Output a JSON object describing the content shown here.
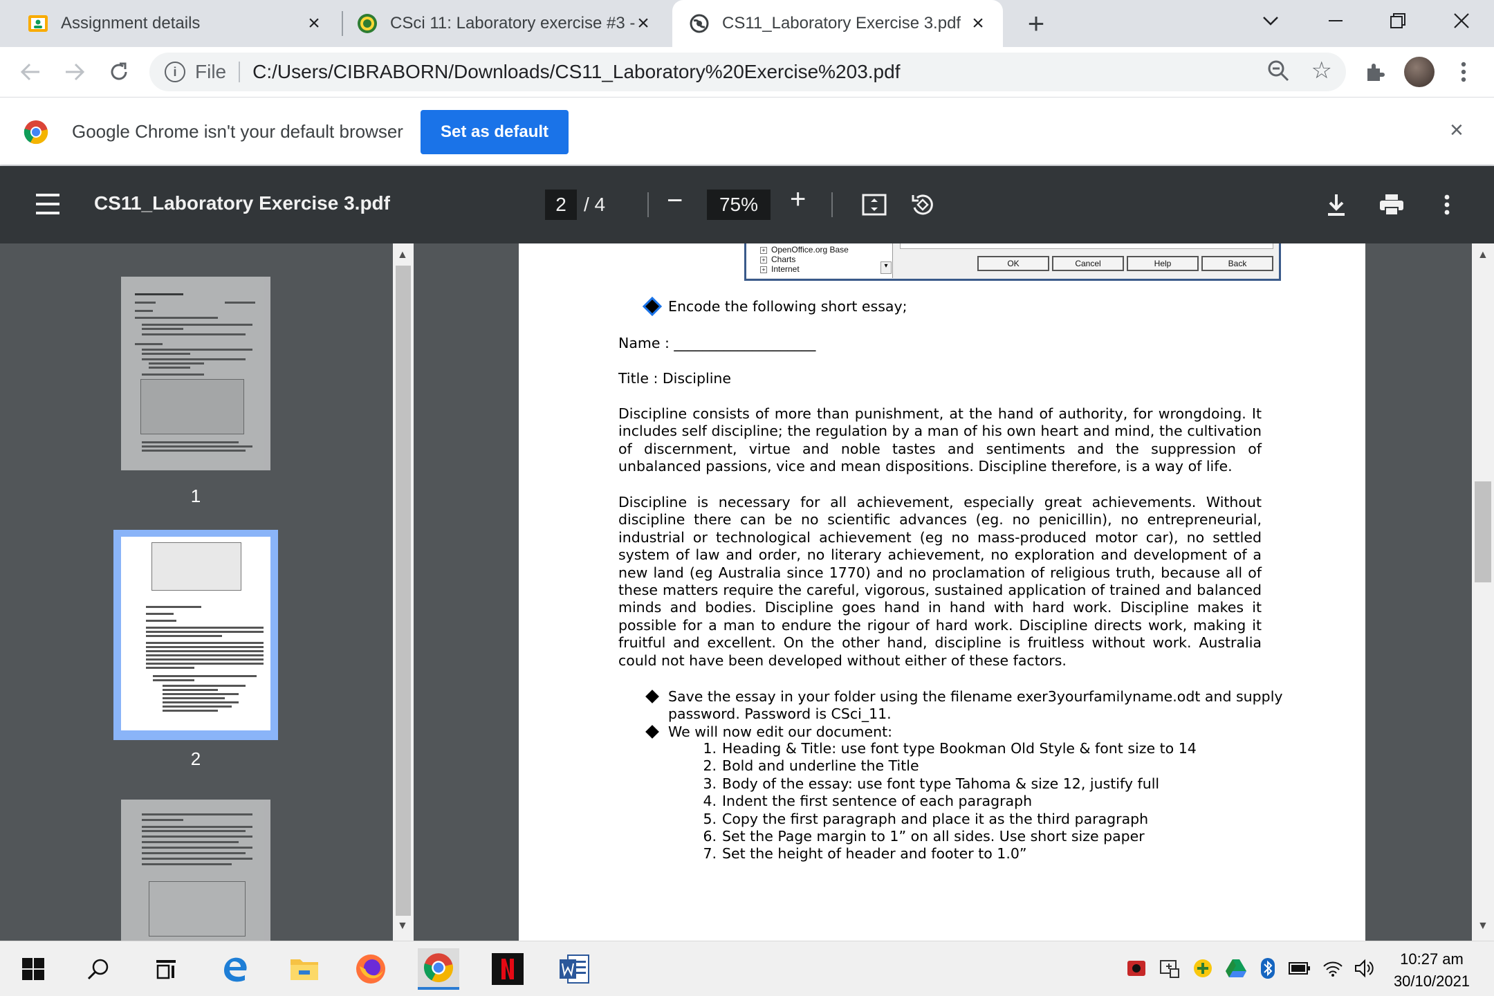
{
  "browser": {
    "tabs": [
      {
        "title": "Assignment details",
        "icon": "classroom-icon"
      },
      {
        "title": "CSci 11: Laboratory exercise #3 -",
        "icon": "university-seal-icon"
      },
      {
        "title": "CS11_Laboratory Exercise 3.pdf",
        "icon": "globe-icon"
      }
    ],
    "address": {
      "scheme_label": "File",
      "url": "C:/Users/CIBRABORN/Downloads/CS11_Laboratory%20Exercise%203.pdf"
    },
    "infobar": {
      "message": "Google Chrome isn't your default browser",
      "button": "Set as default"
    }
  },
  "pdf_viewer": {
    "title": "CS11_Laboratory Exercise 3.pdf",
    "current_page": "2",
    "total_pages": "/ 4",
    "zoom": "75%",
    "thumbnail_labels": [
      "1",
      "2"
    ]
  },
  "document": {
    "dialog": {
      "tree_items": [
        "OpenOffice.org Base",
        "Charts",
        "Internet"
      ],
      "buttons": [
        "OK",
        "Cancel",
        "Help",
        "Back"
      ]
    },
    "bullet_encode": "Encode the following short essay;",
    "name_line": "Name : ____________________",
    "title_line": "Title :  Discipline",
    "paragraph1": "Discipline consists of more than punishment, at the hand of authority, for wrongdoing. It includes self discipline; the regulation by a man of his own heart and mind, the cultivation of discernment, virtue and noble tastes and sentiments and the suppression of unbalanced passions, vice and mean dispositions. Discipline therefore, is a way of life.",
    "paragraph2": "Discipline is necessary for all achievement, especially great achievements. Without discipline there can be no scientific advances (eg. no penicillin), no entrepreneurial, industrial or technological achievement (eg no mass-produced motor car), no settled system of law and order, no literary achievement, no exploration and development of a new land (eg Australia since 1770) and no proclamation of religious truth, because all of these matters require the careful, vigorous, sustained application of trained and balanced minds and bodies. Discipline goes hand in hand with hard work. Discipline makes it possible for a man to endure the rigour of hard work. Discipline directs work, making it fruitful and excellent. On the other hand, discipline is fruitless without work. Australia could not have been developed without either of these factors.",
    "bullet_save_line1": "Save the essay in your folder using the filename exer3yourfamilyname.odt and supply",
    "bullet_save_line2": "password. Password is CSci_11.",
    "bullet_edit": "We will now edit our document:",
    "steps": [
      "Heading & Title: use font type Bookman Old Style & font size to 14",
      "Bold and underline the Title",
      "Body of the essay: use font type Tahoma & size 12, justify full",
      "Indent the first sentence of each paragraph",
      "Copy the first paragraph and place it as the third paragraph",
      "Set the Page margin to 1” on all sides. Use short size paper",
      "Set the height of header and footer to 1.0”"
    ]
  },
  "taskbar": {
    "time": "10:27 am",
    "date": "30/10/2021"
  },
  "colors": {
    "chrome_blue": "#1a73e8",
    "pdf_toolbar": "#323639",
    "pdf_background": "#525659",
    "thumbnail_selected": "#8ab4f8"
  }
}
